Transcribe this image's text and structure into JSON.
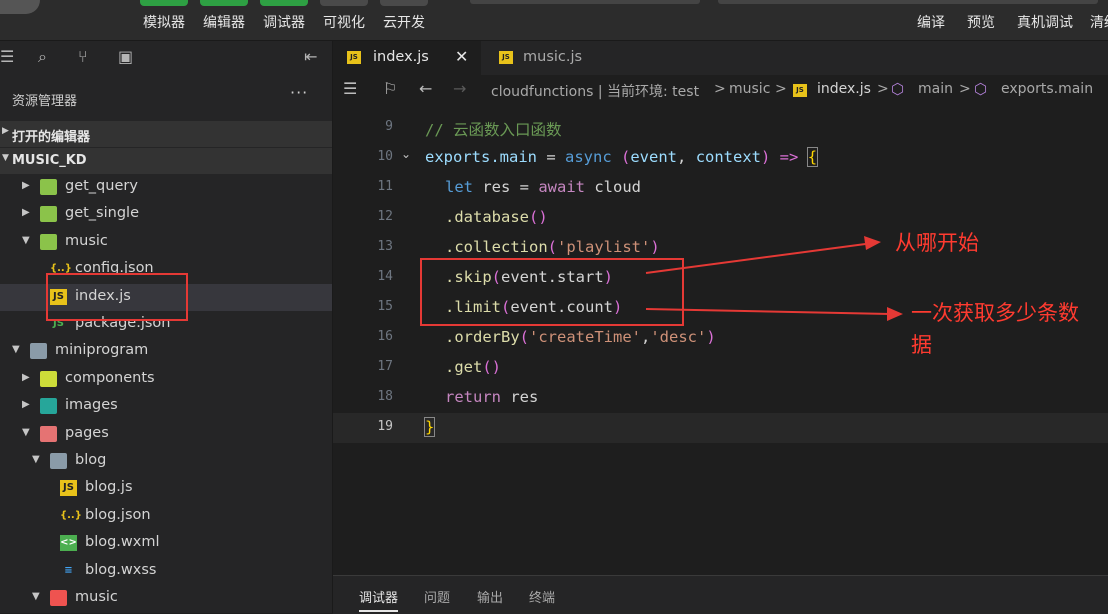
{
  "toolbar": {
    "tools": [
      "模拟器",
      "编辑器",
      "调试器",
      "可视化",
      "云开发"
    ],
    "right_tools": [
      "编译",
      "预览",
      "真机调试",
      "清缓"
    ]
  },
  "sidebar": {
    "title": "资源管理器",
    "more": "···",
    "sections": {
      "open_editors": "打开的编辑器",
      "project": "MUSIC_KD"
    },
    "tree": [
      {
        "name": "get_query",
        "type": "folder-green",
        "depth": 2,
        "arrow": "▶"
      },
      {
        "name": "get_single",
        "type": "folder-green",
        "depth": 2,
        "arrow": "▶"
      },
      {
        "name": "music",
        "type": "folder-green",
        "depth": 2,
        "arrow": "▼"
      },
      {
        "name": "config.json",
        "type": "json",
        "depth": 3,
        "arrow": ""
      },
      {
        "name": "index.js",
        "type": "js",
        "depth": 3,
        "arrow": "",
        "selected": true
      },
      {
        "name": "package.json",
        "type": "pkg",
        "depth": 3,
        "arrow": ""
      },
      {
        "name": "miniprogram",
        "type": "folder",
        "depth": 1,
        "arrow": "▼"
      },
      {
        "name": "components",
        "type": "folder-comp",
        "depth": 2,
        "arrow": "▶"
      },
      {
        "name": "images",
        "type": "folder-img",
        "depth": 2,
        "arrow": "▶"
      },
      {
        "name": "pages",
        "type": "folder-pages",
        "depth": 2,
        "arrow": "▼"
      },
      {
        "name": "blog",
        "type": "folder",
        "depth": 3,
        "arrow": "▼"
      },
      {
        "name": "blog.js",
        "type": "js",
        "depth": 4,
        "arrow": ""
      },
      {
        "name": "blog.json",
        "type": "json",
        "depth": 4,
        "arrow": ""
      },
      {
        "name": "blog.wxml",
        "type": "wxml",
        "depth": 4,
        "arrow": ""
      },
      {
        "name": "blog.wxss",
        "type": "wxss",
        "depth": 4,
        "arrow": ""
      },
      {
        "name": "music",
        "type": "folder-music",
        "depth": 3,
        "arrow": "▼"
      }
    ]
  },
  "tabs": [
    {
      "label": "index.js",
      "active": true,
      "close": "✕"
    },
    {
      "label": "music.js",
      "active": false
    }
  ],
  "breadcrumb": {
    "path": "cloudfunctions | 当前环境: test",
    "music": "music",
    "file": "index.js",
    "main": "main",
    "exports": "exports.main",
    "sep": ">"
  },
  "editor": {
    "lines": [
      {
        "n": "9",
        "html": "cm",
        "text": "// 云函数入口函数"
      },
      {
        "n": "10",
        "fold": true
      },
      {
        "n": "11"
      },
      {
        "n": "12"
      },
      {
        "n": "13"
      },
      {
        "n": "14"
      },
      {
        "n": "15"
      },
      {
        "n": "16"
      },
      {
        "n": "17"
      },
      {
        "n": "18"
      },
      {
        "n": "19"
      }
    ],
    "code": {
      "l9": "// 云函数入口函数",
      "l10_a": "exports",
      "l10_b": ".main",
      "l10_c": " = ",
      "l10_d": "async",
      "l10_e": " (",
      "l10_f": "event",
      "l10_g": ", ",
      "l10_h": "context",
      "l10_i": ") => ",
      "l10_j": "{",
      "l11_a": "let",
      "l11_b": " res = ",
      "l11_c": "await",
      "l11_d": " cloud",
      "l12_a": ".database",
      "l12_b": "()",
      "l13_a": ".collection",
      "l13_b": "(",
      "l13_c": "'playlist'",
      "l13_d": ")",
      "l14_a": ".skip",
      "l14_b": "(",
      "l14_c": "event.start",
      "l14_d": ")",
      "l15_a": ".limit",
      "l15_b": "(",
      "l15_c": "event.count",
      "l15_d": ")",
      "l16_a": ".orderBy",
      "l16_b": "(",
      "l16_c": "'createTime'",
      "l16_d": ",",
      "l16_e": "'desc'",
      "l16_f": ")",
      "l17_a": ".get",
      "l17_b": "()",
      "l18_a": "return",
      "l18_b": " res",
      "l19_a": "}"
    }
  },
  "annotations": {
    "skip_note": "从哪开始",
    "limit_note_1": "一次获取多少条数",
    "limit_note_2": "据"
  },
  "bottom_tabs": [
    "调试器",
    "问题",
    "输出",
    "终端"
  ],
  "colors": {
    "accent_green": "#2ea043",
    "annotation_red": "#e53935",
    "js_yellow": "#e8c21a"
  }
}
